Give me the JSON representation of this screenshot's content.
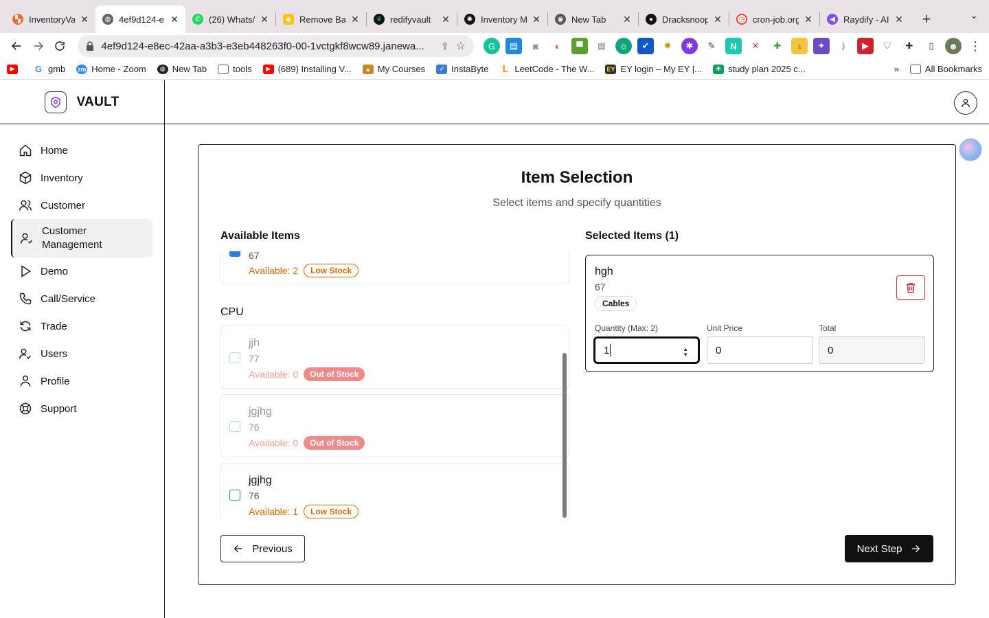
{
  "browser": {
    "tabs": [
      {
        "title": "InventoryVa",
        "icon": "logo-icon",
        "color": "#f06a2b"
      },
      {
        "title": "4ef9d124-e",
        "icon": "globe-icon",
        "color": "#555555",
        "active": true
      },
      {
        "title": "(26) Whats/",
        "icon": "whatsapp-icon",
        "color": "#25d366"
      },
      {
        "title": "Remove Bac",
        "icon": "removebg-icon",
        "color": "#f5c518"
      },
      {
        "title": "redifyvault",
        "icon": "mongodb-icon",
        "color": "#13aa52"
      },
      {
        "title": "Inventory M",
        "icon": "openai-icon",
        "color": "#111111"
      },
      {
        "title": "New Tab",
        "icon": "chrome-icon",
        "color": "#555555"
      },
      {
        "title": "Dracksnoop",
        "icon": "github-icon",
        "color": "#111111"
      },
      {
        "title": "cron-job.org",
        "icon": "clock-icon",
        "color": "#e0482e"
      },
      {
        "title": "Raydify - AI",
        "icon": "raydify-icon",
        "color": "#7b4ff2"
      }
    ],
    "url": "4ef9d124-e8ec-42aa-a3b3-e3eb448263f0-00-1vctgkf8wcw89.janewa...",
    "bookmarks": [
      {
        "label": "",
        "icon": "youtube-icon",
        "color": "#ff0000"
      },
      {
        "label": "gmb",
        "icon": "google-icon",
        "color": "#4285f4"
      },
      {
        "label": "Home - Zoom",
        "icon": "zoom-icon",
        "color": "#2d8cff"
      },
      {
        "label": "New Tab",
        "icon": "chrome-icon",
        "color": "#222222"
      },
      {
        "label": "tools",
        "icon": "folder-icon",
        "color": "#666666"
      },
      {
        "label": "(689) Installing V...",
        "icon": "youtube-icon",
        "color": "#ff0000"
      },
      {
        "label": "My Courses",
        "icon": "courses-icon",
        "color": "#c08a2a"
      },
      {
        "label": "InstaByte",
        "icon": "rocket-icon",
        "color": "#3a7bd5"
      },
      {
        "label": "LeetCode - The W...",
        "icon": "leetcode-icon",
        "color": "#f89f1b"
      },
      {
        "label": "EY login – My EY |...",
        "icon": "ey-icon",
        "color": "#ffe600"
      },
      {
        "label": "study plan 2025 c...",
        "icon": "sheets-icon",
        "color": "#0f9d58"
      }
    ],
    "all_bookmarks": "All Bookmarks",
    "more_bookmarks": "»"
  },
  "brand": {
    "name": "VAULT"
  },
  "sidebar": {
    "items": [
      {
        "label": "Home",
        "icon": "home-icon"
      },
      {
        "label": "Inventory",
        "icon": "box-icon"
      },
      {
        "label": "Customer",
        "icon": "users-icon"
      },
      {
        "label": "Customer Management",
        "icon": "user-check-icon",
        "active": true
      },
      {
        "label": "Demo",
        "icon": "play-icon"
      },
      {
        "label": "Call/Service",
        "icon": "phone-icon"
      },
      {
        "label": "Trade",
        "icon": "refresh-icon"
      },
      {
        "label": "Users",
        "icon": "user-check-icon"
      },
      {
        "label": "Profile",
        "icon": "user-icon"
      },
      {
        "label": "Support",
        "icon": "lifebuoy-icon"
      }
    ]
  },
  "page": {
    "title": "Item Selection",
    "subtitle": "Select items and specify quantities",
    "available_heading": "Available Items",
    "selected_heading": "Selected Items (1)"
  },
  "available": {
    "partial_item": {
      "code": "67",
      "avail": "Available: 2",
      "badge": "Low Stock"
    },
    "group": "CPU",
    "items": [
      {
        "name": "jjh",
        "code": "77",
        "avail": "Available: 0",
        "badge": "Out of Stock"
      },
      {
        "name": "jgjhg",
        "code": "76",
        "avail": "Available: 0",
        "badge": "Out of Stock"
      },
      {
        "name": "jgjhg",
        "code": "76",
        "avail": "Available: 1",
        "badge": "Low Stock"
      }
    ]
  },
  "selected": {
    "name": "hgh",
    "code": "67",
    "category": "Cables",
    "quantity_label": "Quantity (Max: 2)",
    "quantity": "1",
    "unit_price_label": "Unit Price",
    "unit_price": "0",
    "total_label": "Total",
    "total": "0"
  },
  "buttons": {
    "previous": "Previous",
    "next": "Next Step"
  }
}
